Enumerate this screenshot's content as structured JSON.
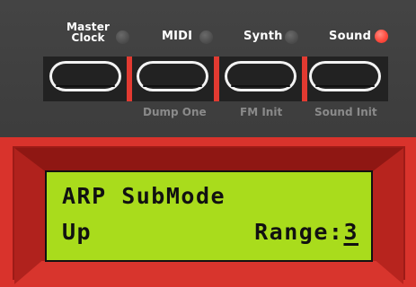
{
  "modes": [
    {
      "label": "Master\nClock",
      "led_on": false
    },
    {
      "label": "MIDI",
      "led_on": false
    },
    {
      "label": "Synth",
      "led_on": false
    },
    {
      "label": "Sound",
      "led_on": true
    }
  ],
  "shift_labels": [
    "Dump One",
    "FM Init",
    "Sound Init"
  ],
  "display": {
    "line1": "ARP SubMode",
    "line2_left": "Up",
    "line2_right_label": "Range:",
    "line2_right_value": "3"
  },
  "colors": {
    "lcd": "#a9dc1c",
    "bezel": "#d9332c",
    "led_on": "#ff4b3e",
    "led_off": "#4a4a4a"
  }
}
